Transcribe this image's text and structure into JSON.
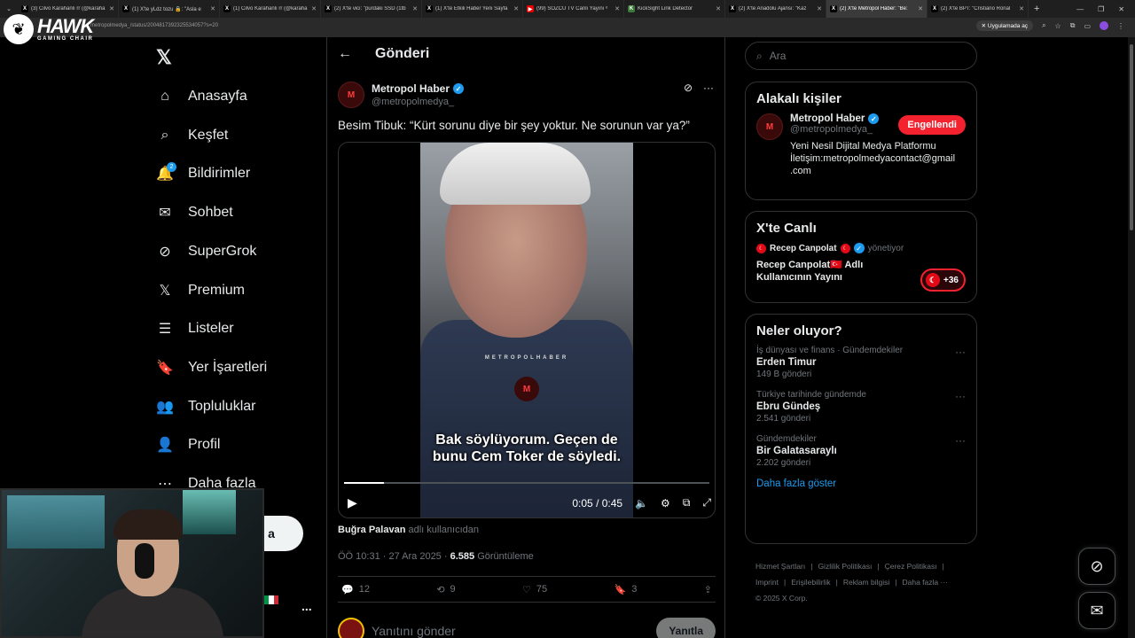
{
  "browser": {
    "tabs": [
      {
        "title": "(3) Cilvo Karahanlı rr (@karaha",
        "fav": "X",
        "favbg": "#000",
        "favfg": "#fff"
      },
      {
        "title": "(1) X'te yLdz tozu 🔒: \"Asla e",
        "fav": "X",
        "favbg": "#000",
        "favfg": "#fff"
      },
      {
        "title": "(1) Cilvo Karahanlı rr (@karaha",
        "fav": "X",
        "favbg": "#000",
        "favfg": "#fff"
      },
      {
        "title": "(2) X'te vici: \"purdaki SSD (1tb",
        "fav": "X",
        "favbg": "#000",
        "favfg": "#fff"
      },
      {
        "title": "(1) X'te Etkili Haber Yeni Sayfa",
        "fav": "X",
        "favbg": "#000",
        "favfg": "#fff"
      },
      {
        "title": "(99) SÖZCÜ TV Canlı Yayını ᵒ",
        "fav": "▶",
        "favbg": "#e00",
        "favfg": "#fff"
      },
      {
        "title": "KickSight Link Detector",
        "fav": "K",
        "favbg": "#3a7a3a",
        "favfg": "#fff"
      },
      {
        "title": "(2) X'te Anadolu Ajansı: \"Kaz",
        "fav": "X",
        "favbg": "#000",
        "favfg": "#fff"
      },
      {
        "title": "(2) X'te Metropol Haber: \"Be:",
        "fav": "X",
        "favbg": "#000",
        "favfg": "#fff"
      },
      {
        "title": "(2) X'te BPT: \"Cristiano Ronal",
        "fav": "X",
        "favbg": "#000",
        "favfg": "#fff"
      }
    ],
    "active_tab": 8,
    "url": "metropolmedya_/status/2004817392325534057?s=20",
    "app_chip": "Uygulamada aç"
  },
  "watermark": {
    "brand": "HAWK",
    "sub": "GAMING CHAIR"
  },
  "nav": {
    "items": [
      {
        "label": "Anasayfa",
        "icon": "home-icon",
        "glyph": "⌂",
        "badge": ""
      },
      {
        "label": "Keşfet",
        "icon": "search-icon",
        "glyph": "⌕",
        "badge": ""
      },
      {
        "label": "Bildirimler",
        "icon": "bell-icon",
        "glyph": "🔔",
        "badge": "2"
      },
      {
        "label": "Sohbet",
        "icon": "mail-icon",
        "glyph": "✉",
        "badge": ""
      },
      {
        "label": "SuperGrok",
        "icon": "grok-icon",
        "glyph": "⊘",
        "badge": ""
      },
      {
        "label": "Premium",
        "icon": "x-premium-icon",
        "glyph": "𝕏",
        "badge": ""
      },
      {
        "label": "Listeler",
        "icon": "list-icon",
        "glyph": "☰",
        "badge": ""
      },
      {
        "label": "Yer İşaretleri",
        "icon": "bookmark-icon",
        "glyph": "🔖",
        "badge": ""
      },
      {
        "label": "Topluluklar",
        "icon": "communities-icon",
        "glyph": "👥",
        "badge": ""
      },
      {
        "label": "Profil",
        "icon": "profile-icon",
        "glyph": "👤",
        "badge": ""
      },
      {
        "label": "Daha fazla",
        "icon": "more-circle-icon",
        "glyph": "⋯",
        "badge": ""
      }
    ],
    "post_button_fragment": "a",
    "account_more": "..."
  },
  "main": {
    "header_title": "Gönderi",
    "author": {
      "name": "Metropol Haber",
      "handle": "@metropolmedya_",
      "avatar_letter": "M"
    },
    "text": "Besim Tibuk: “Kürt sorunu diye bir şey yoktur. Ne sorunun var ya?”",
    "video": {
      "watermark": "METROPOLHABER",
      "subtitle_line1": "Bak söylüyorum. Geçen de",
      "subtitle_line2": "bunu Cem Toker de söyledi.",
      "time": "0:05 / 0:45",
      "progress": 0.11
    },
    "reply_user": "Buğra Palavan",
    "reply_suffix": "adlı kullanıcıdan",
    "timestamp": "ÖÖ 10:31 · 27 Ara 2025 ·",
    "views": "6.585",
    "views_label": "Görüntüleme",
    "stats": {
      "replies": "12",
      "reposts": "9",
      "likes": "75",
      "bookmarks": "3"
    },
    "composer": {
      "placeholder": "Yanıtını gönder",
      "button": "Yanıtla"
    }
  },
  "right": {
    "search_placeholder": "Ara",
    "related": {
      "title": "Alakalı kişiler",
      "name": "Metropol Haber",
      "handle": "@metropolmedya_",
      "bio_line1": "Yeni Nesil Dijital Medya Platformu",
      "bio_line2": "İletişim:metropolmedyacontact@gmail",
      "bio_line3": ".com",
      "button": "Engellendi"
    },
    "live": {
      "title": "X'te Canlı",
      "host": "Recep Canpolat",
      "host_suffix": "yönetiyor",
      "stream_title": "Recep Canpolat🇹🇷 Adlı Kullanıcının Yayını",
      "count": "+36"
    },
    "trends": {
      "title": "Neler oluyor?",
      "items": [
        {
          "cat": "İş dünyası ve finans · Gündemdekiler",
          "name": "Erden Timur",
          "count": "149 B gönderi"
        },
        {
          "cat": "Türkiye tarihinde gündemde",
          "name": "Ebru Gündeş",
          "count": "2.541 gönderi"
        },
        {
          "cat": "Gündemdekiler",
          "name": "Bir Galatasaraylı",
          "count": "2.202 gönderi"
        }
      ],
      "more": "Daha fazla göster"
    },
    "footer": {
      "links": [
        "Hizmet Şartları",
        "Gizlilik Politikası",
        "Çerez Politikası",
        "Imprint",
        "Erişilebilirlik",
        "Reklam bilgisi",
        "Daha fazla ···"
      ],
      "copyright": "© 2025 X Corp."
    }
  },
  "colors": {
    "accent": "#1d9bf0",
    "danger": "#f4212e",
    "bg": "#000000",
    "muted": "#71767b"
  }
}
